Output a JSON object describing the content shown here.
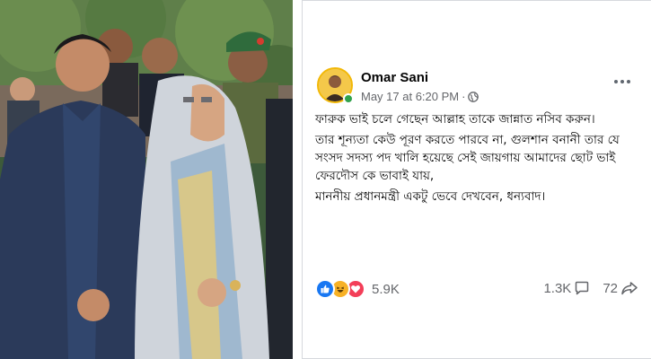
{
  "post": {
    "author": "Omar Sani",
    "timestamp": "May 17 at 6:20 PM",
    "separator": "·",
    "audience_icon": "globe-icon",
    "paragraphs": [
      "ফারুক ভাই চলে গেছেন আল্লাহ তাকে জান্নাত নসিব করুন।",
      "তার শূন্যতা কেউ পূরণ করতে পারবে না, গুলশান বনানী তার যে সংসদ সদস্য পদ খালি হয়েছে সেই জায়গায় আমাদের ছোট ভাই ফেরদৌস কে ভাবাই যায়,",
      "মাননীয় প্রধানমন্ত্রী একটু ভেবে দেখবেন, ধন্যবাদ।"
    ],
    "reaction_count": "5.9K",
    "comment_count": "1.3K",
    "share_count": "72",
    "reaction_icons": [
      "like-icon",
      "haha-icon",
      "love-icon"
    ]
  },
  "colors": {
    "like": "#1877f2",
    "love": "#f33e58",
    "haha": "#f7b125",
    "secondary_text": "#65676b",
    "online": "#31a24c"
  }
}
